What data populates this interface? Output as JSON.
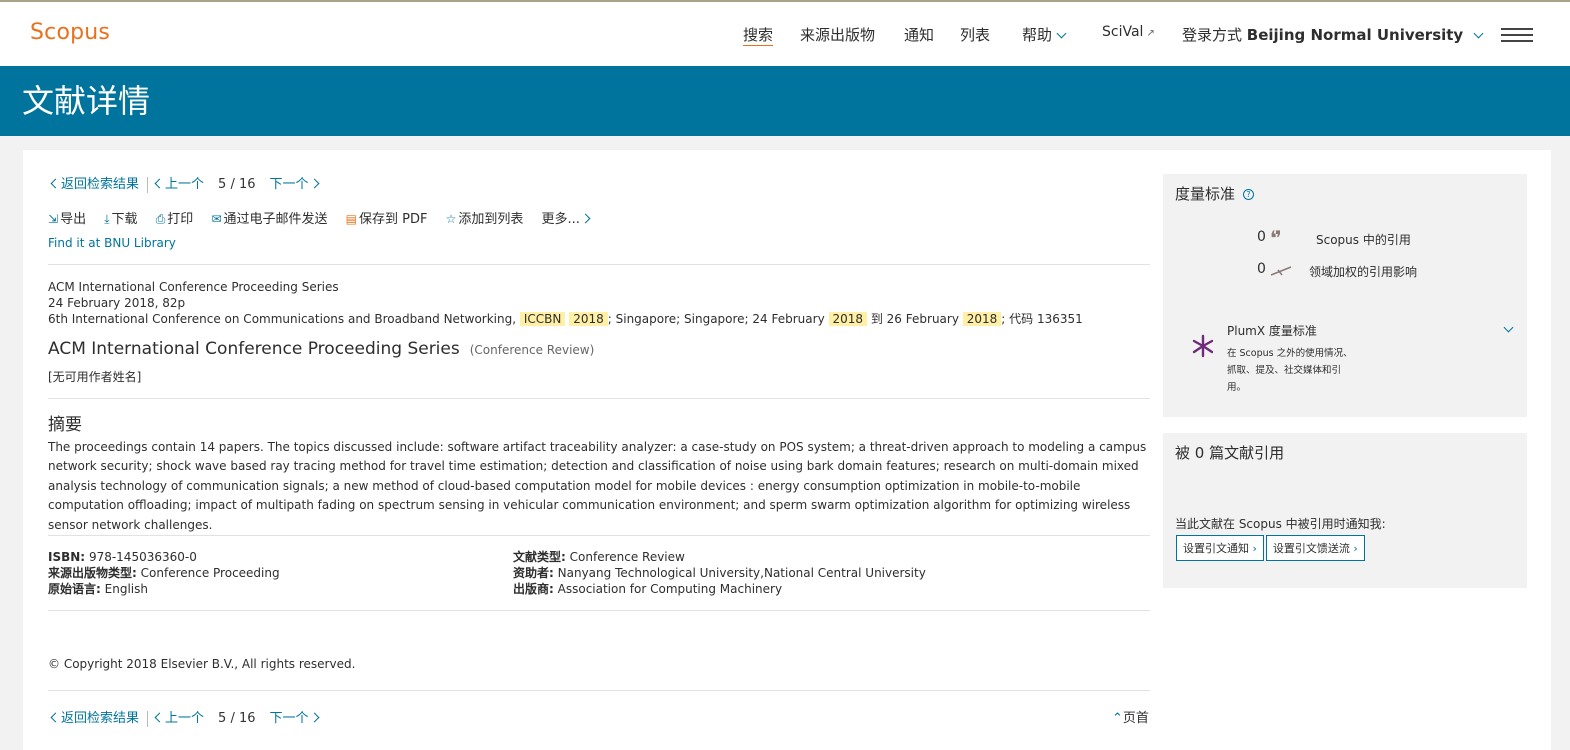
{
  "header": {
    "logo": "Scopus",
    "nav": {
      "search": "搜索",
      "sources": "来源出版物",
      "alerts": "通知",
      "lists": "列表",
      "help": "帮助",
      "scival": "SciVal",
      "login_prefix": "登录方式",
      "login_org": "Beijing Normal University"
    }
  },
  "banner": {
    "title": "文献详情"
  },
  "doc_nav": {
    "back": "返回检索结果",
    "prev": "上一个",
    "current": "5",
    "slash": "/",
    "total": "16",
    "next": "下一个"
  },
  "actions": {
    "export": "导出",
    "download": "下载",
    "print": "打印",
    "email": "通过电子邮件发送",
    "save_pdf": "保存到 PDF",
    "add_list": "添加到列表",
    "more": "更多..."
  },
  "library_link": "Find it at BNU Library",
  "meta": {
    "series": "ACM International Conference Proceeding Series",
    "date_pages": "24 February 2018, 82p",
    "conf_prefix": "6th International Conference on Communications and Broadband Networking, ",
    "hl_acronym": "ICCBN",
    "hl_year1": "2018",
    "conf_mid": "; Singapore; Singapore; 24 February ",
    "hl_year2": "2018",
    "conf_mid2": " 到 26 February ",
    "hl_year3": "2018",
    "conf_suffix": "; 代码 136351"
  },
  "doc_title": "ACM International Conference Proceeding Series",
  "doc_type_label": "(Conference Review)",
  "authors": "[无可用作者姓名]",
  "abstract": {
    "heading": "摘要",
    "text": "The proceedings contain 14 papers. The topics discussed include: software artifact traceability analyzer: a case-study on POS system; a threat-driven approach to modeling a campus network security; shock wave based ray tracing method for travel time estimation; detection and classification of noise using bark domain features; research on multi-domain mixed analysis technology of communication signals; a new method of cloud-based computation model for mobile devices : energy consumption optimization in mobile-to-mobile computation offloading; impact of multipath fading on spectrum sensing in vehicular communication environment; and sperm swarm optimization algorithm for optimizing wireless sensor network challenges."
  },
  "details": {
    "isbn_label": "ISBN:",
    "isbn": "978-145036360-0",
    "source_type_label": "来源出版物类型:",
    "source_type": "Conference Proceeding",
    "language_label": "原始语言:",
    "language": "English",
    "doc_type_label": "文献类型:",
    "doc_type": "Conference Review",
    "sponsors_label": "资助者:",
    "sponsors": "Nanyang Technological University,National Central University",
    "publisher_label": "出版商:",
    "publisher": "Association for Computing Machinery"
  },
  "copyright": "© Copyright 2018 Elsevier B.V., All rights reserved.",
  "top_link": "页首",
  "metrics": {
    "heading": "度量标准",
    "help": "?",
    "citations_count": "0",
    "citations_label": "Scopus 中的引用",
    "fwci_count": "0",
    "fwci_label": "领域加权的引用影响",
    "plumx_title": "PlumX 度量标准",
    "plumx_desc1": "在 Scopus 之外的使用情况、",
    "plumx_desc2": "抓取、提及、社交媒体和引",
    "plumx_desc3": "用。"
  },
  "cited_by": {
    "heading": "被 0 篇文献引用",
    "alert_text": "当此文献在 Scopus 中被引用时通知我:",
    "btn_alert": "设置引文通知",
    "btn_feed": "设置引文馈送流"
  },
  "colors": {
    "brand_orange": "#e9711c",
    "banner_blue": "#00749d",
    "highlight": "#fff0a6"
  }
}
